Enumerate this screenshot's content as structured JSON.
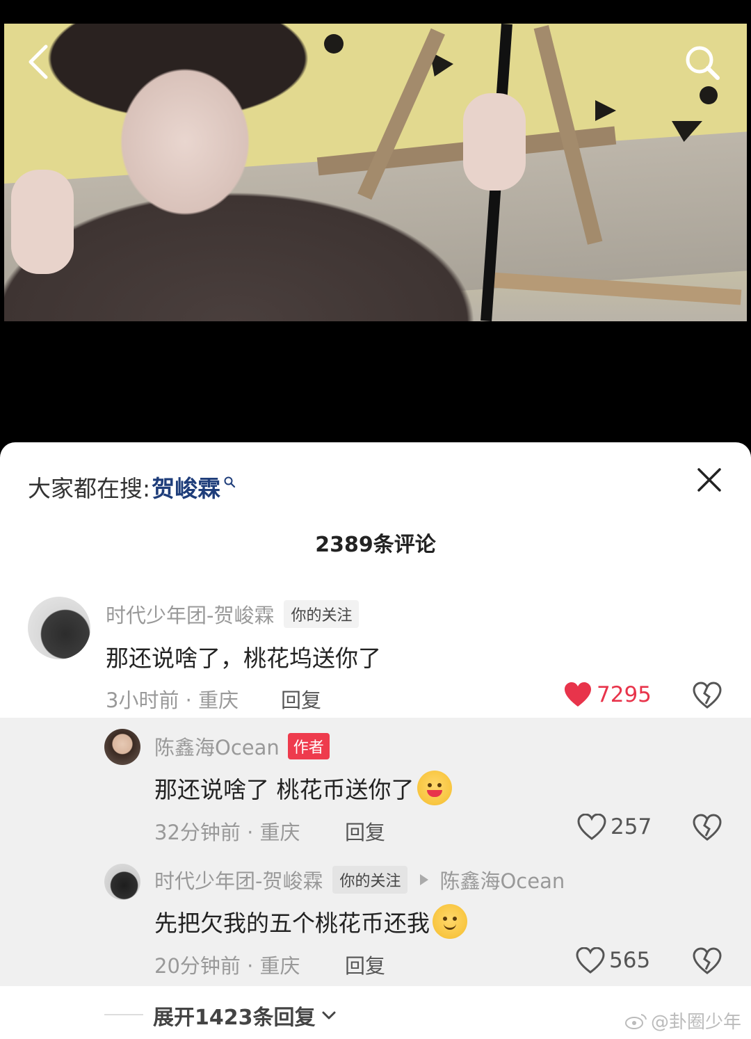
{
  "video": {
    "back_icon": "chevron-left-icon",
    "search_icon": "search-icon"
  },
  "panel": {
    "trend_prefix": "大家都在搜:",
    "trend_keyword": "贺峻霖",
    "close_icon": "close-icon",
    "comment_count": "2389条评论"
  },
  "comments": [
    {
      "username": "时代少年团-贺峻霖",
      "tag": "你的关注",
      "text": "那还说啥了，桃花坞送你了",
      "time_location": "3小时前 · 重庆",
      "reply_label": "回复",
      "likes": "7295",
      "liked": true
    }
  ],
  "replies": [
    {
      "username": "陈鑫海Ocean",
      "tag": "作者",
      "text": "那还说啥了 桃花币送你了",
      "emoji": "hugging-emoji",
      "time_location": "32分钟前 · 重庆",
      "reply_label": "回复",
      "likes": "257"
    },
    {
      "username": "时代少年团-贺峻霖",
      "tag": "你的关注",
      "reply_to": "陈鑫海Ocean",
      "text": "先把欠我的五个桃花币还我",
      "emoji": "smile-emoji",
      "time_location": "20分钟前 · 重庆",
      "reply_label": "回复",
      "likes": "565"
    }
  ],
  "expand": {
    "label": "展开1423条回复"
  },
  "watermark": "@卦圈少年",
  "colors": {
    "like_red": "#e8344b",
    "author_tag": "#ee3b4d",
    "keyword_blue": "#1e3d7a"
  }
}
